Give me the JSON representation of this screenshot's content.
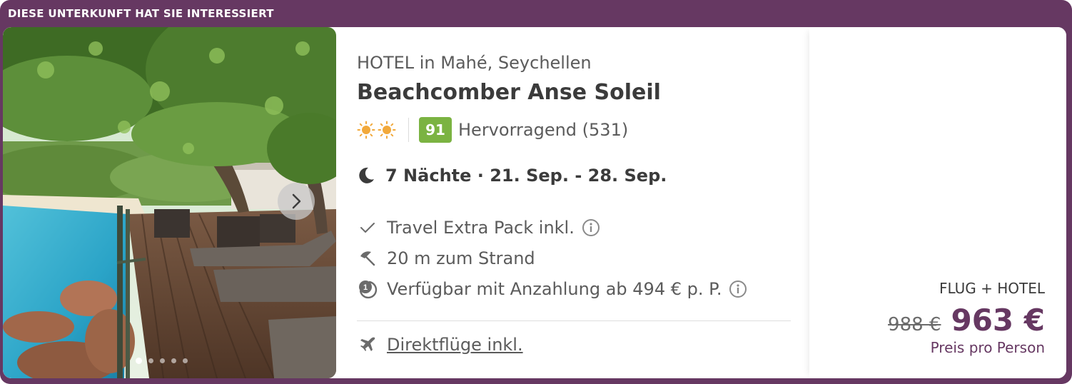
{
  "banner": {
    "text": "DIESE UNTERKUNFT HAT SIE INTERESSIERT"
  },
  "hotel": {
    "subtitle": "HOTEL in Mahé, Seychellen",
    "name": "Beachcomber Anse Soleil",
    "stars_count": 2,
    "score": "91",
    "rating_text": "Hervorragend (531)",
    "dates": "7 Nächte · 21. Sep. - 28. Sep."
  },
  "features": {
    "pack": "Travel Extra Pack inkl.",
    "beach": "20 m zum Strand",
    "deposit": "Verfügbar mit Anzahlung ab 494 € p. P.",
    "flights": "Direktflüge inkl."
  },
  "gallery": {
    "image_count": 5,
    "active_index": 0
  },
  "price": {
    "type": "FLUG + HOTEL",
    "old": "988 €",
    "new": "963 €",
    "per_person": "Preis pro Person"
  },
  "colors": {
    "brand": "#663862",
    "score_badge": "#7bb342",
    "star": "#f2a93b"
  },
  "icons": [
    "sun-star-icon",
    "moon-icon",
    "check-icon",
    "info-icon",
    "beach-umbrella-icon",
    "deposit-clock-icon",
    "airplane-icon",
    "chevron-right-icon"
  ]
}
